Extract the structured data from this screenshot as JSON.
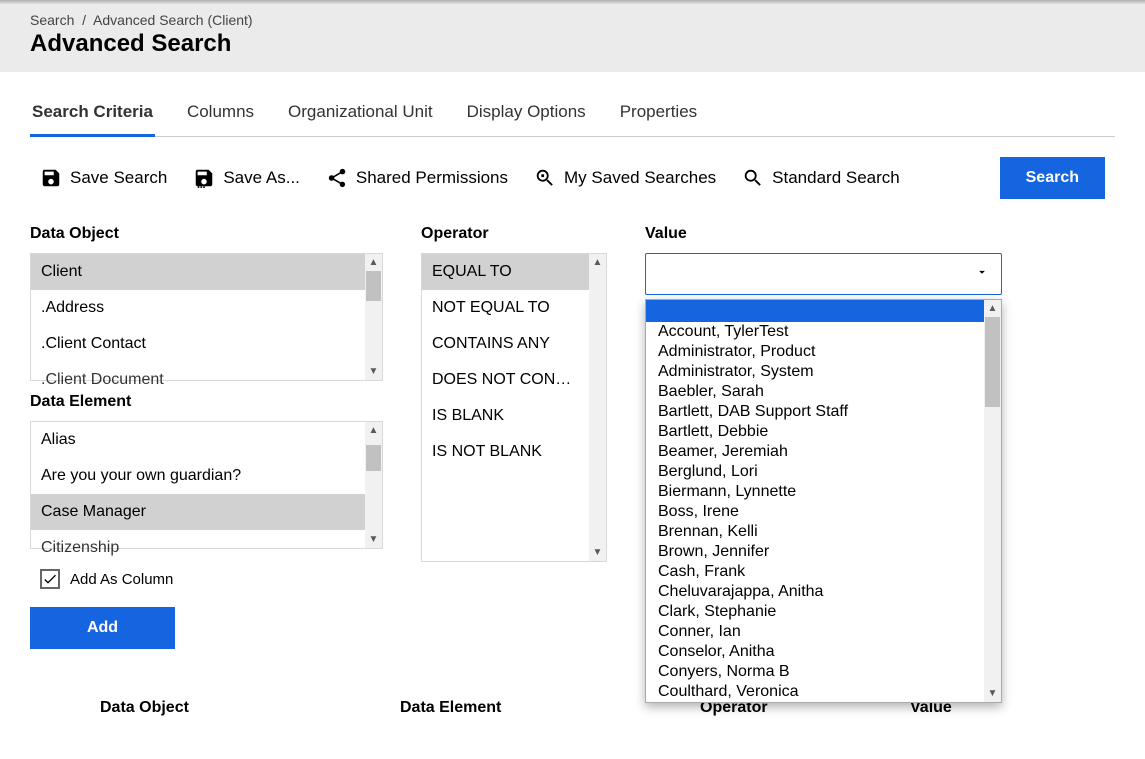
{
  "breadcrumb": {
    "root": "Search",
    "sep": "/",
    "current": "Advanced Search (Client)"
  },
  "page_title": "Advanced Search",
  "tabs": [
    {
      "label": "Search Criteria",
      "active": true
    },
    {
      "label": "Columns",
      "active": false
    },
    {
      "label": "Organizational Unit",
      "active": false
    },
    {
      "label": "Display Options",
      "active": false
    },
    {
      "label": "Properties",
      "active": false
    }
  ],
  "toolbar": {
    "save_search": "Save Search",
    "save_as": "Save As...",
    "shared_permissions": "Shared Permissions",
    "my_saved_searches": "My Saved Searches",
    "standard_search": "Standard Search",
    "search_button": "Search"
  },
  "labels": {
    "data_object": "Data Object",
    "data_element": "Data Element",
    "operator": "Operator",
    "value": "Value",
    "add_as_column": "Add As Column",
    "add_button": "Add"
  },
  "data_object": {
    "selected": "Client",
    "options": [
      "Client",
      ".Address",
      ".Client Contact",
      ".Client Document"
    ]
  },
  "data_element": {
    "selected": "Case Manager",
    "options": [
      "Alias",
      "Are you your own guardian?",
      "Case Manager",
      "Citizenship"
    ]
  },
  "operator": {
    "selected": "EQUAL TO",
    "options": [
      "EQUAL TO",
      "NOT EQUAL TO",
      "CONTAINS ANY",
      "DOES NOT CONTAIN",
      "IS BLANK",
      "IS NOT BLANK"
    ]
  },
  "value_dropdown": {
    "selected": "",
    "options": [
      "Account, TylerTest",
      "Administrator, Product",
      "Administrator, System",
      "Baebler, Sarah",
      "Bartlett, DAB Support Staff",
      "Bartlett, Debbie",
      "Beamer, Jeremiah",
      "Berglund, Lori",
      "Biermann, Lynnette",
      "Boss, Irene",
      "Brennan, Kelli",
      "Brown, Jennifer",
      "Cash, Frank",
      "Cheluvarajappa, Anitha",
      "Clark, Stephanie",
      "Conner, Ian",
      "Conselor, Anitha",
      "Conyers, Norma B",
      "Coulthard, Veronica"
    ]
  },
  "checkbox": {
    "add_as_column_checked": true
  },
  "results_columns": [
    "Data Object",
    "Data Element",
    "Operator",
    "Value"
  ]
}
